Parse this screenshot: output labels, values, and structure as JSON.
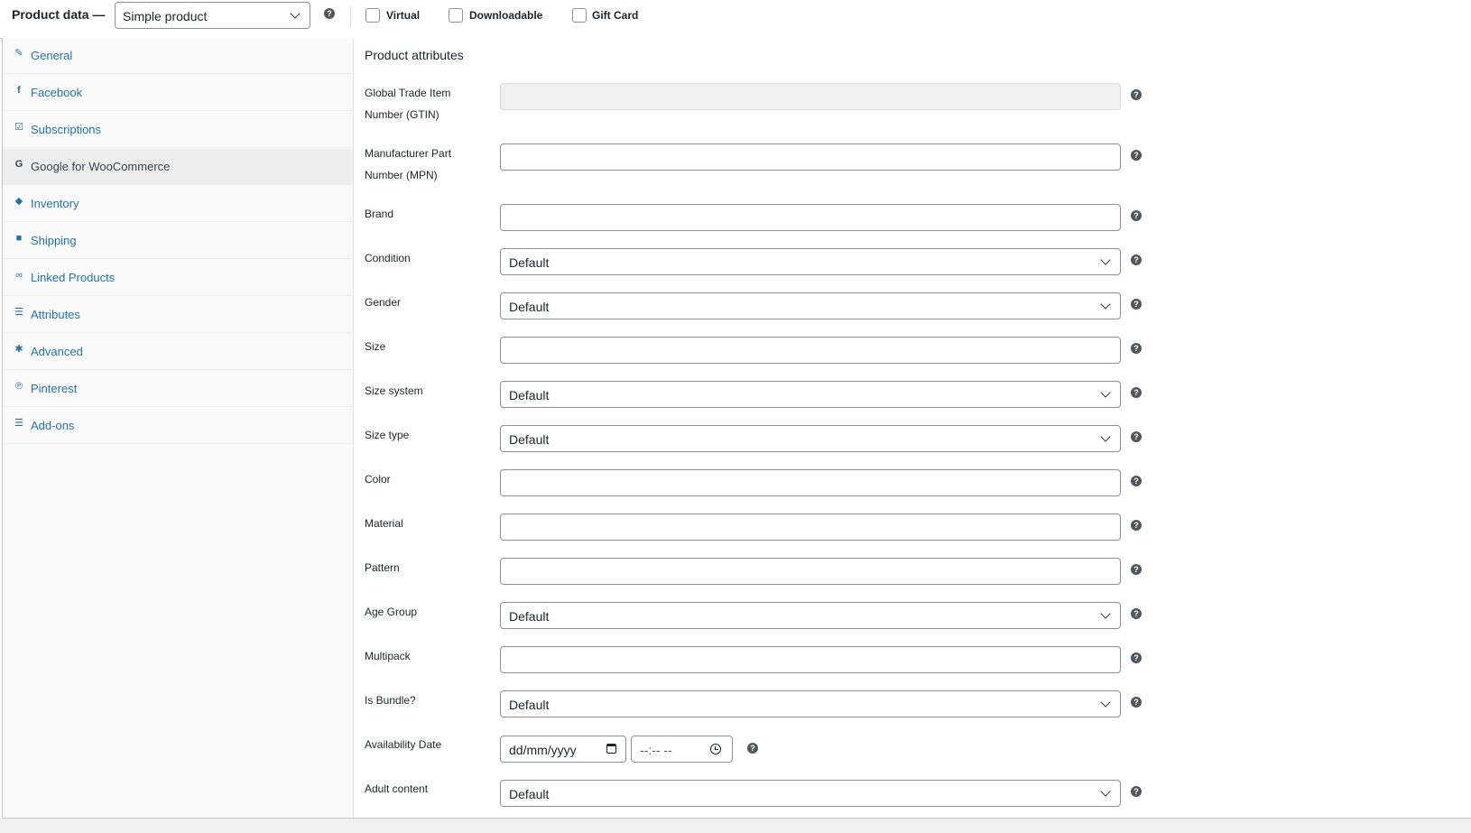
{
  "header": {
    "title": "Product data —",
    "product_type": "Simple product",
    "options": [
      {
        "label": "Virtual",
        "checked": false
      },
      {
        "label": "Downloadable",
        "checked": false
      },
      {
        "label": "Gift Card",
        "checked": false
      }
    ]
  },
  "sidebar": {
    "tabs": [
      {
        "label": "General",
        "icon": "wrench-icon",
        "active": false
      },
      {
        "label": "Facebook",
        "icon": "facebook-icon",
        "active": false
      },
      {
        "label": "Subscriptions",
        "icon": "calendar-check-icon",
        "active": false
      },
      {
        "label": "Google for WooCommerce",
        "icon": "google-icon",
        "active": true
      },
      {
        "label": "Inventory",
        "icon": "tag-icon",
        "active": false
      },
      {
        "label": "Shipping",
        "icon": "truck-icon",
        "active": false
      },
      {
        "label": "Linked Products",
        "icon": "link-icon",
        "active": false
      },
      {
        "label": "Attributes",
        "icon": "list-icon",
        "active": false
      },
      {
        "label": "Advanced",
        "icon": "gear-icon",
        "active": false
      },
      {
        "label": "Pinterest",
        "icon": "pinterest-icon",
        "active": false
      },
      {
        "label": "Add-ons",
        "icon": "list-icon",
        "active": false
      }
    ]
  },
  "main": {
    "section_title": "Product attributes",
    "fields": [
      {
        "label": "Global Trade Item Number (GTIN)",
        "type": "text",
        "value": "",
        "disabled": true
      },
      {
        "label": "Manufacturer Part Number (MPN)",
        "type": "text",
        "value": ""
      },
      {
        "label": "Brand",
        "type": "text",
        "value": ""
      },
      {
        "label": "Condition",
        "type": "select",
        "value": "Default"
      },
      {
        "label": "Gender",
        "type": "select",
        "value": "Default"
      },
      {
        "label": "Size",
        "type": "text",
        "value": ""
      },
      {
        "label": "Size system",
        "type": "select",
        "value": "Default"
      },
      {
        "label": "Size type",
        "type": "select",
        "value": "Default"
      },
      {
        "label": "Color",
        "type": "text",
        "value": ""
      },
      {
        "label": "Material",
        "type": "text",
        "value": ""
      },
      {
        "label": "Pattern",
        "type": "text",
        "value": ""
      },
      {
        "label": "Age Group",
        "type": "select",
        "value": "Default"
      },
      {
        "label": "Multipack",
        "type": "text",
        "value": ""
      },
      {
        "label": "Is Bundle?",
        "type": "select",
        "value": "Default"
      }
    ],
    "availability_date": {
      "label": "Availability Date",
      "date_placeholder": "dd/mm/yyyy",
      "time_placeholder": "--:-- --"
    },
    "adult_content": {
      "label": "Adult content",
      "value": "Default"
    }
  },
  "colors": {
    "link": "#2271b1",
    "active_tab_bg": "#eeeeee",
    "border": "#8c8f94"
  }
}
